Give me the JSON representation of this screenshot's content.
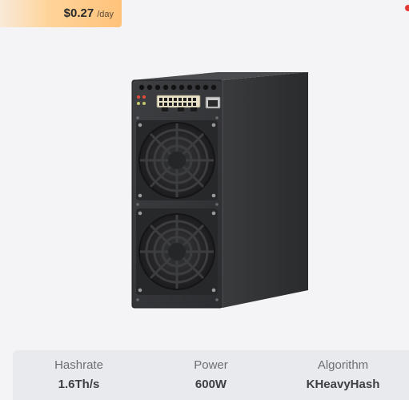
{
  "profit": {
    "value": "$0.27",
    "unit": "/day",
    "accent_color": "#ffc27a"
  },
  "product": {
    "image_icon": "asic-miner-image"
  },
  "specs": [
    {
      "label": "Hashrate",
      "value": "1.6Th/s"
    },
    {
      "label": "Power",
      "value": "600W"
    },
    {
      "label": "Algorithm",
      "value": "KHeavyHash"
    }
  ]
}
